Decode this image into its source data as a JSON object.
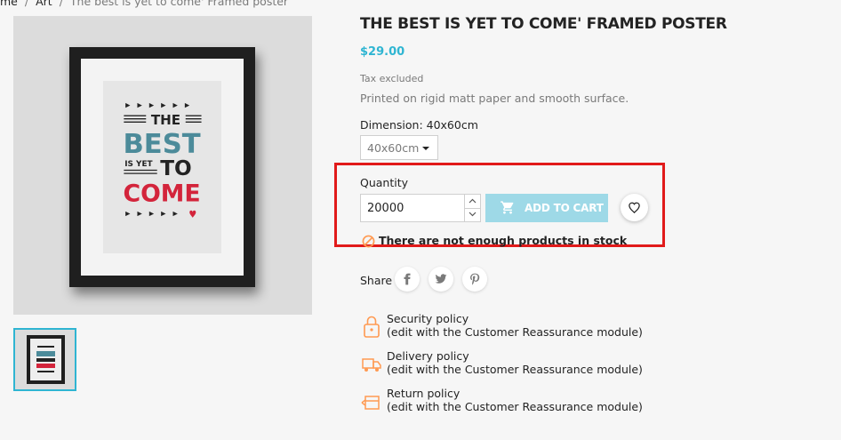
{
  "breadcrumb": {
    "items": [
      "me",
      "Art",
      "The best is yet to come' Framed poster"
    ],
    "separator": "/"
  },
  "poster_art": {
    "line1": "THE",
    "line2": "BEST",
    "line3a": "IS YET",
    "line3b": "TO",
    "line4": "COME"
  },
  "product": {
    "title": "THE BEST IS YET TO COME' FRAMED POSTER",
    "price": "$29.00",
    "tax_note": "Tax excluded",
    "description": "Printed on rigid matt paper and smooth surface."
  },
  "variant": {
    "dimension_label": "Dimension: 40x60cm",
    "selected": "40x60cm"
  },
  "purchase": {
    "quantity_label": "Quantity",
    "quantity_value": "20000",
    "add_to_cart_label": "ADD TO CART",
    "stock_message": "There are not enough products in stock"
  },
  "share": {
    "label": "Share",
    "networks": [
      "facebook-icon",
      "twitter-icon",
      "pinterest-icon"
    ]
  },
  "reassurance": [
    {
      "title": "Security policy",
      "subtitle": "(edit with the Customer Reassurance module)",
      "icon": "shield-lock-icon"
    },
    {
      "title": "Delivery policy",
      "subtitle": "(edit with the Customer Reassurance module)",
      "icon": "truck-icon"
    },
    {
      "title": "Return policy",
      "subtitle": "(edit with the Customer Reassurance module)",
      "icon": "return-box-icon"
    }
  ],
  "colors": {
    "accent": "#2fb5d2",
    "button_disabled": "#9ed9e7",
    "highlight": "#e11a1a",
    "poster_teal": "#4c8b9a",
    "poster_red": "#d3243b",
    "warning_orange": "#ff9a52"
  }
}
